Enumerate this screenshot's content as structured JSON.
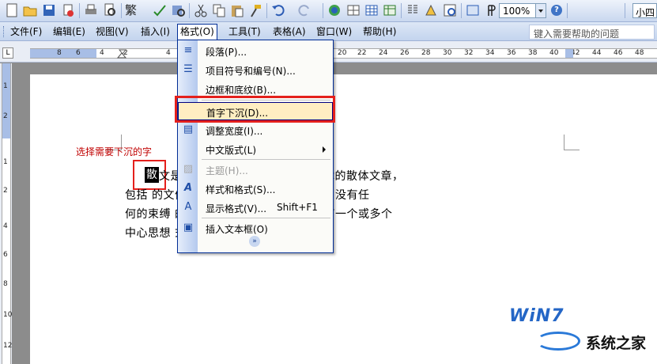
{
  "toolbar": {
    "traditional_label": "繁",
    "zoom": "100%",
    "font_size": "小四"
  },
  "menubar": {
    "items": [
      {
        "label": "文件(F)"
      },
      {
        "label": "编辑(E)"
      },
      {
        "label": "视图(V)"
      },
      {
        "label": "插入(I)"
      },
      {
        "label": "格式(O)"
      },
      {
        "label": "工具(T)"
      },
      {
        "label": "表格(A)"
      },
      {
        "label": "窗口(W)"
      },
      {
        "label": "帮助(H)"
      }
    ],
    "help_placeholder": "键入需要帮助的问题"
  },
  "ruler": {
    "tab_button": "L",
    "numbers": [
      "8",
      "6",
      "4",
      "2",
      "2",
      "4",
      "20",
      "22",
      "24",
      "26",
      "28",
      "30",
      "32",
      "34",
      "36",
      "38",
      "40",
      "42",
      "44",
      "46",
      "48"
    ],
    "v_numbers": [
      "1",
      "2",
      "1",
      "2",
      "4",
      "6",
      "8",
      "10",
      "12"
    ]
  },
  "format_menu": {
    "items": [
      {
        "label": "段落(P)...",
        "icon": "paragraph-icon"
      },
      {
        "label": "项目符号和编号(N)...",
        "icon": "bullets-icon"
      },
      {
        "label": "边框和底纹(B)..."
      },
      {
        "label": "首字下沉(D)..."
      },
      {
        "label": "调整宽度(I)...",
        "icon": "fit-width-icon"
      },
      {
        "label": "中文版式(L)",
        "submenu": true
      },
      {
        "label": "主题(H)...",
        "disabled": true,
        "icon": "theme-icon"
      },
      {
        "label": "样式和格式(S)...",
        "icon": "styles-icon"
      },
      {
        "label": "显示格式(V)...",
        "shortcut": "Shift+F1",
        "icon": "reveal-format-icon"
      },
      {
        "label": "插入文本框(O)",
        "icon": "textbox-icon"
      }
    ],
    "expand_glyph": "»"
  },
  "document": {
    "annotation": "选择需要下沉的字",
    "drop_char": "散",
    "line1": "文是                                     一种文学体裁，指不讲究韵律的散体文章，",
    "line2": "包括                                     的文体，不讲究音韵，不讲究排比，没有任",
    "line3": "何的束缚                              的行文体例。通常一篇散文具有一个或多个",
    "line4": "中心思想                              式表达。",
    "para_mark": "↵"
  },
  "watermark": {
    "logo": "WiN7",
    "site": "系统之家"
  }
}
